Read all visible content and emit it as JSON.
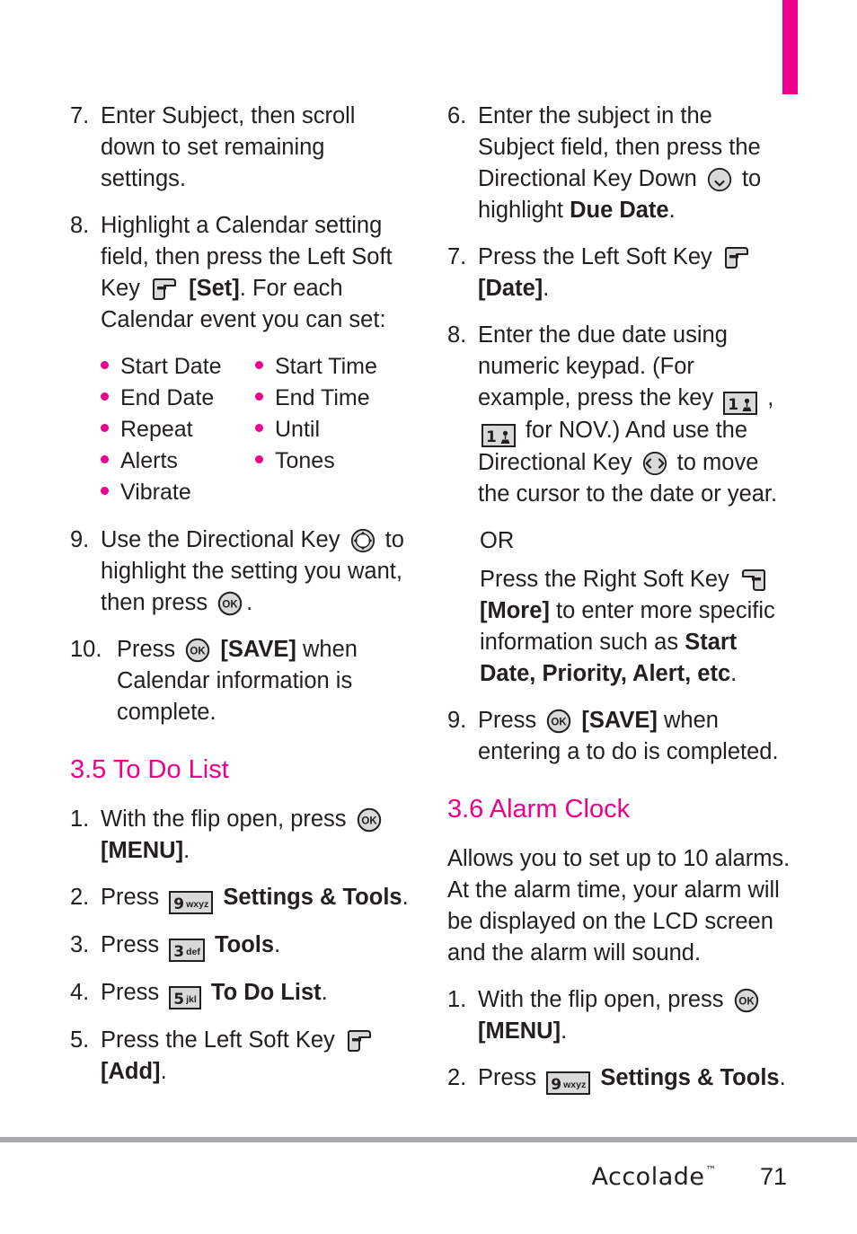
{
  "page": {
    "number": "71",
    "brand": "Accolade",
    "trademark": "™",
    "accent_color": "#ec008c",
    "text_color": "#231f20",
    "rule_color": "#a7a9ac"
  },
  "left_column": {
    "steps": [
      {
        "num": "7.",
        "parts": [
          {
            "type": "text",
            "value": "Enter Subject, then scroll down to set remaining settings."
          }
        ]
      },
      {
        "num": "8.",
        "parts": [
          {
            "type": "text",
            "value": "Highlight a Calendar setting field, then press the Left Soft Key "
          },
          {
            "type": "icon",
            "value": "left-soft-key-icon"
          },
          {
            "type": "bold",
            "value": " [Set]"
          },
          {
            "type": "text",
            "value": ". For each Calendar event you can set:"
          }
        ]
      }
    ],
    "bullets_col1": [
      "Start Date",
      "End Date",
      "Repeat",
      "Alerts",
      "Vibrate"
    ],
    "bullets_col2": [
      "Start Time",
      "End Time",
      "Until",
      "Tones"
    ],
    "steps_after_bullets": [
      {
        "num": "9.",
        "parts": [
          {
            "type": "text",
            "value": "Use the Directional Key "
          },
          {
            "type": "icon",
            "value": "directional-key-all-icon"
          },
          {
            "type": "text",
            "value": " to highlight the setting you want, then press "
          },
          {
            "type": "icon",
            "value": "ok-key-icon"
          },
          {
            "type": "text",
            "value": "."
          }
        ]
      },
      {
        "num": "10.",
        "parts": [
          {
            "type": "text",
            "value": "Press "
          },
          {
            "type": "icon",
            "value": "ok-key-icon"
          },
          {
            "type": "bold",
            "value": " [SAVE]"
          },
          {
            "type": "text",
            "value": " when Calendar information is complete."
          }
        ]
      }
    ],
    "heading": "3.5 To Do List",
    "todo_steps": [
      {
        "num": "1.",
        "parts": [
          {
            "type": "text",
            "value": "With the flip open, press "
          },
          {
            "type": "icon",
            "value": "ok-key-icon"
          },
          {
            "type": "bold",
            "value": " [MENU]"
          },
          {
            "type": "text",
            "value": "."
          }
        ]
      },
      {
        "num": "2.",
        "parts": [
          {
            "type": "text",
            "value": "Press "
          },
          {
            "type": "key",
            "digit": "9",
            "letters": "wxyz"
          },
          {
            "type": "bold",
            "value": " Settings & Tools"
          },
          {
            "type": "text",
            "value": "."
          }
        ]
      },
      {
        "num": "3.",
        "parts": [
          {
            "type": "text",
            "value": "Press "
          },
          {
            "type": "key",
            "digit": "3",
            "letters": "def"
          },
          {
            "type": "bold",
            "value": " Tools"
          },
          {
            "type": "text",
            "value": "."
          }
        ]
      },
      {
        "num": "4.",
        "parts": [
          {
            "type": "text",
            "value": "Press "
          },
          {
            "type": "key",
            "digit": "5",
            "letters": "jkl"
          },
          {
            "type": "bold",
            "value": " To Do List"
          },
          {
            "type": "text",
            "value": "."
          }
        ]
      },
      {
        "num": "5.",
        "parts": [
          {
            "type": "text",
            "value": "Press the Left Soft Key "
          },
          {
            "type": "icon",
            "value": "left-soft-key-icon"
          },
          {
            "type": "bold",
            "value": " [Add]"
          },
          {
            "type": "text",
            "value": "."
          }
        ]
      }
    ]
  },
  "right_column": {
    "steps": [
      {
        "num": "6.",
        "parts": [
          {
            "type": "text",
            "value": "Enter the subject in the Subject field, then press the Directional Key Down "
          },
          {
            "type": "icon",
            "value": "directional-key-down-icon"
          },
          {
            "type": "text",
            "value": " to highlight "
          },
          {
            "type": "bold",
            "value": "Due Date"
          },
          {
            "type": "text",
            "value": "."
          }
        ]
      },
      {
        "num": "7.",
        "parts": [
          {
            "type": "text",
            "value": "Press the Left Soft Key "
          },
          {
            "type": "icon",
            "value": "left-soft-key-icon"
          },
          {
            "type": "bold",
            "value": " [Date]"
          },
          {
            "type": "text",
            "value": "."
          }
        ]
      },
      {
        "num": "8.",
        "parts": [
          {
            "type": "text",
            "value": "Enter the due date using numeric keypad. (For example, press the key "
          },
          {
            "type": "key",
            "digit": "1",
            "glyph": "voicemail"
          },
          {
            "type": "text",
            "value": " , "
          },
          {
            "type": "key",
            "digit": "1",
            "glyph": "voicemail"
          },
          {
            "type": "text",
            "value": " for NOV.) And use the Directional Key "
          },
          {
            "type": "icon",
            "value": "directional-key-leftright-icon"
          },
          {
            "type": "text",
            "value": " to move the cursor to the date or year."
          }
        ]
      }
    ],
    "or_label": "OR",
    "or_paragraph": [
      {
        "type": "text",
        "value": "Press the Right Soft Key "
      },
      {
        "type": "icon",
        "value": "right-soft-key-icon"
      },
      {
        "type": "bold",
        "value": " [More]"
      },
      {
        "type": "text",
        "value": " to enter more specific information such as "
      },
      {
        "type": "bold",
        "value": "Start Date, Priority, Alert, etc"
      },
      {
        "type": "text",
        "value": "."
      }
    ],
    "step_nine": {
      "num": "9.",
      "parts": [
        {
          "type": "text",
          "value": "Press "
        },
        {
          "type": "icon",
          "value": "ok-key-icon"
        },
        {
          "type": "bold",
          "value": " [SAVE]"
        },
        {
          "type": "text",
          "value": " when entering a to do is completed."
        }
      ]
    },
    "heading": "3.6 Alarm Clock",
    "intro": "Allows you to set up to 10 alarms. At the alarm time, your alarm will be displayed on the LCD screen and the alarm will sound.",
    "alarm_steps": [
      {
        "num": "1.",
        "parts": [
          {
            "type": "text",
            "value": "With the flip open, press "
          },
          {
            "type": "icon",
            "value": "ok-key-icon"
          },
          {
            "type": "bold",
            "value": " [MENU]"
          },
          {
            "type": "text",
            "value": "."
          }
        ]
      },
      {
        "num": "2.",
        "parts": [
          {
            "type": "text",
            "value": "Press "
          },
          {
            "type": "key",
            "digit": "9",
            "letters": "wxyz"
          },
          {
            "type": "bold",
            "value": " Settings & Tools"
          },
          {
            "type": "text",
            "value": "."
          }
        ]
      }
    ]
  }
}
